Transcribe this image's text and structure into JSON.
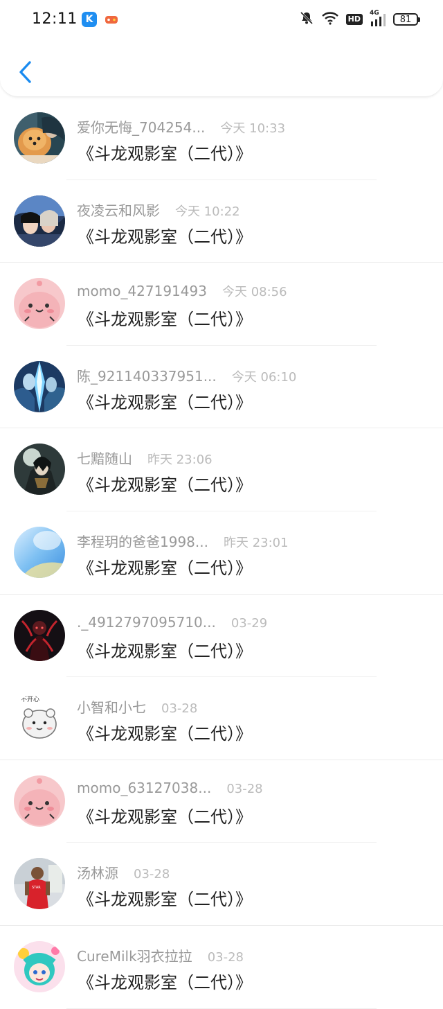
{
  "status": {
    "time": "12:11",
    "battery": "81",
    "network": "4G",
    "hd": "HD"
  },
  "header": {
    "back_icon": "chevron-left-icon",
    "accent_color": "#1a8bf0"
  },
  "items": [
    {
      "name": "爱你无悔_704254...",
      "date": "今天 10:33",
      "message": "《斗龙观影室（二代）》",
      "avatar": "dog-photo"
    },
    {
      "name": "夜凌云和风影",
      "date": "今天 10:22",
      "message": "《斗龙观影室（二代）》",
      "avatar": "anime-portrait"
    },
    {
      "name": "momo_427191493",
      "date": "今天 08:56",
      "message": "《斗龙观影室（二代）》",
      "avatar": "pink-momo"
    },
    {
      "name": "陈_921140337951...",
      "date": "今天 06:10",
      "message": "《斗龙观影室（二代）》",
      "avatar": "blue-fantasy"
    },
    {
      "name": "七黯随山",
      "date": "昨天 23:06",
      "message": "《斗龙观影室（二代）》",
      "avatar": "dark-anime"
    },
    {
      "name": "李程玥的爸爸1998...",
      "date": "昨天 23:01",
      "message": "《斗龙观影室（二代）》",
      "avatar": "blue-gradient"
    },
    {
      "name": "._4912797095710...",
      "date": "03-29",
      "message": "《斗龙观影室（二代）》",
      "avatar": "red-dark-figure"
    },
    {
      "name": "小智和小七",
      "date": "03-28",
      "message": "《斗龙观影室（二代）》",
      "avatar": "hamster-drawing"
    },
    {
      "name": "momo_63127038...",
      "date": "03-28",
      "message": "《斗龙观影室（二代）》",
      "avatar": "pink-momo"
    },
    {
      "name": "汤林源",
      "date": "03-28",
      "message": "《斗龙观影室（二代）》",
      "avatar": "boy-red-shirt"
    },
    {
      "name": "CureMilk羽衣拉拉",
      "date": "03-28",
      "message": "《斗龙观影室（二代）》",
      "avatar": "anime-girl-teal"
    }
  ]
}
